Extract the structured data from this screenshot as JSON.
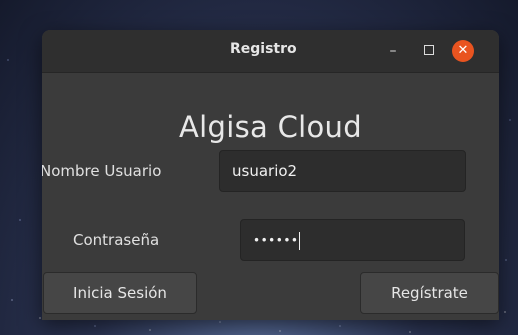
{
  "window": {
    "title": "Registro",
    "minimize_glyph": "–",
    "close_glyph": "✕"
  },
  "app": {
    "heading": "Algisa Cloud"
  },
  "form": {
    "username_label": "Nombre Usuario",
    "username_value": "usuario2",
    "password_label": "Contraseña",
    "password_value": "••••••"
  },
  "buttons": {
    "login_label": "Inicia Sesión",
    "register_label": "Regístrate"
  },
  "colors": {
    "close_button": "#e95420",
    "window_bg": "#3b3b3b",
    "titlebar_bg": "#2f2f2f"
  }
}
